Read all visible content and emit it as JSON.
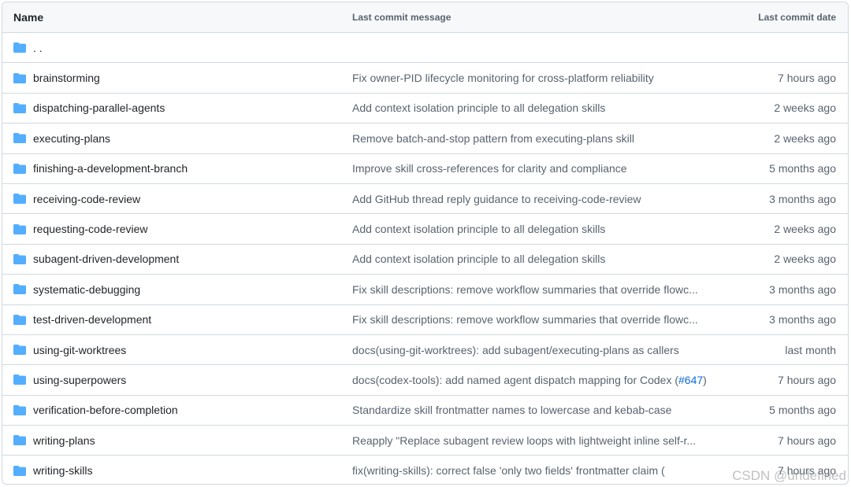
{
  "header": {
    "name": "Name",
    "message": "Last commit message",
    "date": "Last commit date"
  },
  "parent_row": {
    "name": ". ."
  },
  "rows": [
    {
      "name": "brainstorming",
      "message": "Fix owner-PID lifecycle monitoring for cross-platform reliability",
      "date": "7 hours ago"
    },
    {
      "name": "dispatching-parallel-agents",
      "message": "Add context isolation principle to all delegation skills",
      "date": "2 weeks ago"
    },
    {
      "name": "executing-plans",
      "message": "Remove batch-and-stop pattern from executing-plans skill",
      "date": "2 weeks ago"
    },
    {
      "name": "finishing-a-development-branch",
      "message": "Improve skill cross-references for clarity and compliance",
      "date": "5 months ago"
    },
    {
      "name": "receiving-code-review",
      "message": "Add GitHub thread reply guidance to receiving-code-review",
      "date": "3 months ago"
    },
    {
      "name": "requesting-code-review",
      "message": "Add context isolation principle to all delegation skills",
      "date": "2 weeks ago"
    },
    {
      "name": "subagent-driven-development",
      "message": "Add context isolation principle to all delegation skills",
      "date": "2 weeks ago"
    },
    {
      "name": "systematic-debugging",
      "message": "Fix skill descriptions: remove workflow summaries that override flowc...",
      "date": "3 months ago"
    },
    {
      "name": "test-driven-development",
      "message": "Fix skill descriptions: remove workflow summaries that override flowc...",
      "date": "3 months ago"
    },
    {
      "name": "using-git-worktrees",
      "message": "docs(using-git-worktrees): add subagent/executing-plans as callers",
      "date": "last month"
    },
    {
      "name": "using-superpowers",
      "message": "docs(codex-tools): add named agent dispatch mapping for Codex (",
      "message_link": "#647",
      "message_suffix": ")",
      "date": "7 hours ago"
    },
    {
      "name": "verification-before-completion",
      "message": "Standardize skill frontmatter names to lowercase and kebab-case",
      "date": "5 months ago"
    },
    {
      "name": "writing-plans",
      "message": "Reapply \"Replace subagent review loops with lightweight inline self-r...",
      "date": "7 hours ago"
    },
    {
      "name": "writing-skills",
      "message": "fix(writing-skills): correct false 'only two fields' frontmatter claim (",
      "date": "7 hours ago"
    }
  ],
  "watermark": "CSDN @undefined",
  "colors": {
    "folder": "#54aeff",
    "link": "#0969da",
    "border": "#d1d9e0",
    "header_bg": "#f6f8fa"
  },
  "icons": {
    "folder": "folder-icon"
  }
}
